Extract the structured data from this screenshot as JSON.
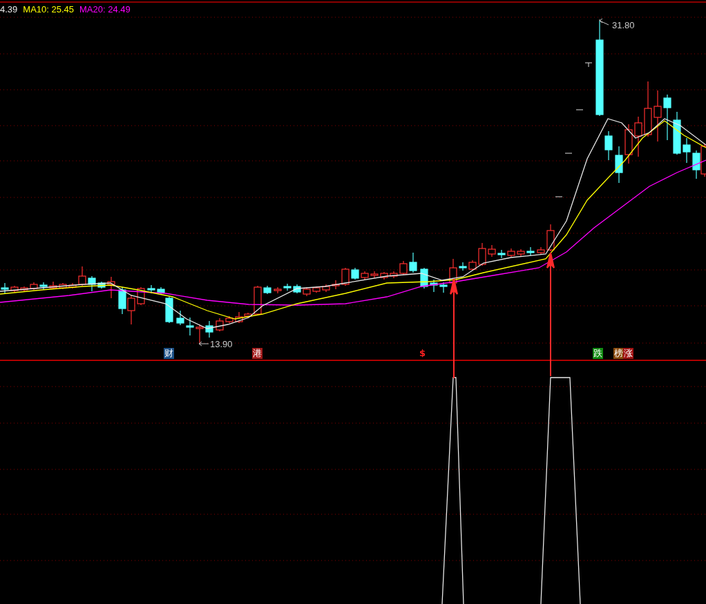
{
  "legend": [
    {
      "text": "4.39",
      "color": "#e8e8e8"
    },
    {
      "text": "MA10: 25.45",
      "color": "#ffff00"
    },
    {
      "text": "MA20: 24.49",
      "color": "#ff00ff"
    }
  ],
  "price_labels": [
    {
      "kind": "high",
      "text": "31.80"
    },
    {
      "kind": "low",
      "text": "13.90"
    }
  ],
  "markers": [
    {
      "kind": "badge",
      "text": "财",
      "color": "#1b4f86"
    },
    {
      "kind": "badge",
      "text": "港",
      "color": "#a01818"
    },
    {
      "kind": "plain",
      "text": "$",
      "color": "#ff2020"
    },
    {
      "kind": "badge",
      "text": "跌",
      "color": "#118a11"
    },
    {
      "kind": "badge",
      "text": "榜",
      "color": "#8a4a0c"
    },
    {
      "kind": "badge",
      "text": "涨",
      "color": "#a01010"
    }
  ]
}
